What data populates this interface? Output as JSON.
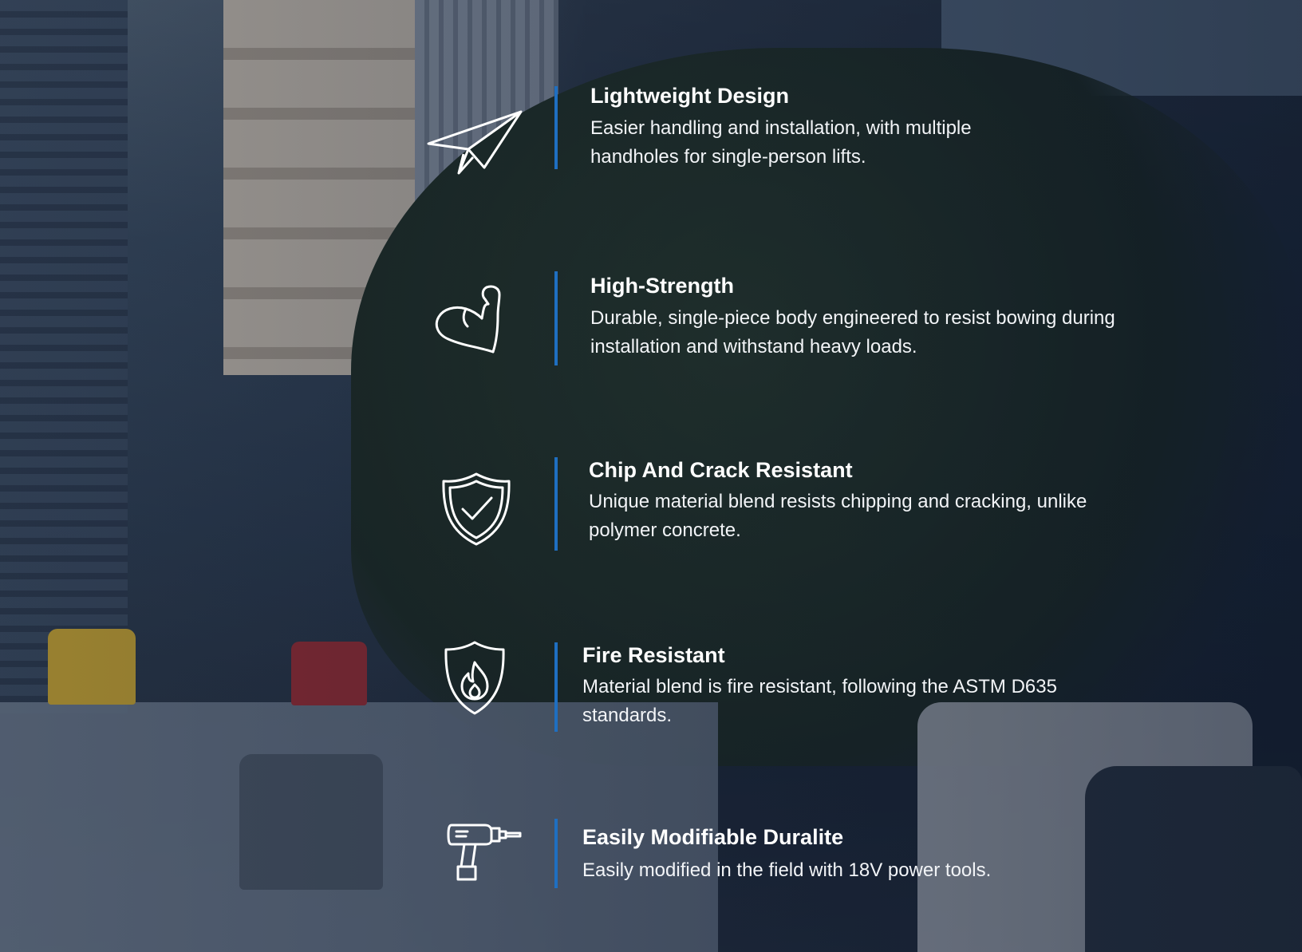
{
  "features": [
    {
      "title": "Lightweight Design",
      "description": "Easier handling and installation, with multiple handholes for single-person lifts.",
      "icon": "paper-plane-icon"
    },
    {
      "title": "High-Strength",
      "description": "Durable, single-piece body engineered to resist bowing during installation and withstand heavy loads.",
      "icon": "flexed-arm-icon"
    },
    {
      "title": "Chip And Crack Resistant",
      "description": "Unique material blend resists chipping and cracking, unlike polymer concrete.",
      "icon": "shield-check-icon"
    },
    {
      "title": "Fire Resistant",
      "description": "Material blend is fire resistant, following the ASTM D635 standards.",
      "icon": "shield-flame-icon"
    },
    {
      "title": "Easily Modifiable Duralite",
      "description": "Easily modified in the field with 18V power tools.",
      "icon": "power-drill-icon"
    }
  ],
  "colors": {
    "accent_bar": "#1f6fc1",
    "text": "#ffffff"
  }
}
